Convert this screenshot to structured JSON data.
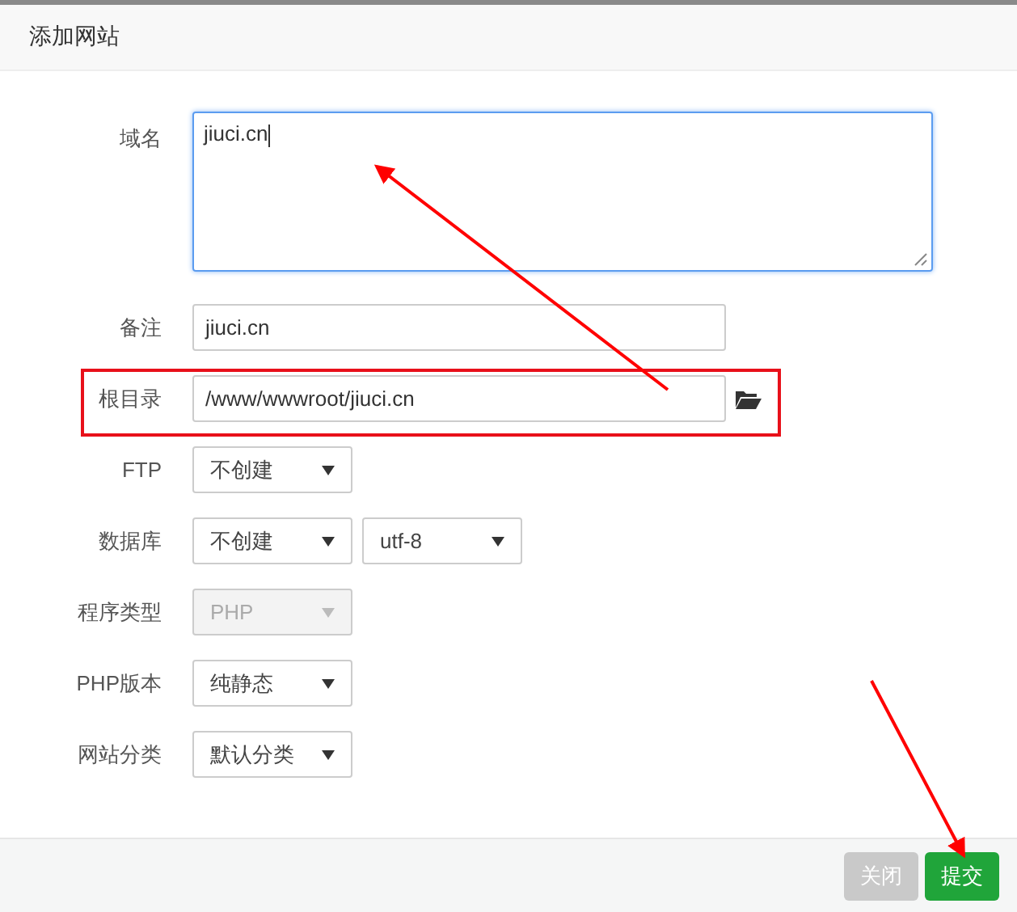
{
  "dialog": {
    "title": "添加网站"
  },
  "fields": [
    {
      "kind": "textarea",
      "label": "域名",
      "value": "jiuci.cn",
      "focused": true
    },
    {
      "kind": "input",
      "label": "备注",
      "value": "jiuci.cn"
    },
    {
      "kind": "path",
      "label": "根目录",
      "value": "/www/wwwroot/jiuci.cn",
      "highlighted": true
    },
    {
      "kind": "select",
      "label": "FTP",
      "options": [
        {
          "value": "不创建",
          "disabled": false
        }
      ]
    },
    {
      "kind": "select",
      "label": "数据库",
      "options": [
        {
          "value": "不创建",
          "disabled": false
        },
        {
          "value": "utf-8",
          "disabled": false
        }
      ]
    },
    {
      "kind": "select",
      "label": "程序类型",
      "options": [
        {
          "value": "PHP",
          "disabled": true
        }
      ]
    },
    {
      "kind": "select",
      "label": "PHP版本",
      "options": [
        {
          "value": "纯静态",
          "disabled": false
        }
      ]
    },
    {
      "kind": "select",
      "label": "网站分类",
      "options": [
        {
          "value": "默认分类",
          "disabled": false
        }
      ]
    }
  ],
  "buttons": [
    {
      "kind": "close",
      "label": "关闭"
    },
    {
      "kind": "submit",
      "label": "提交"
    }
  ]
}
